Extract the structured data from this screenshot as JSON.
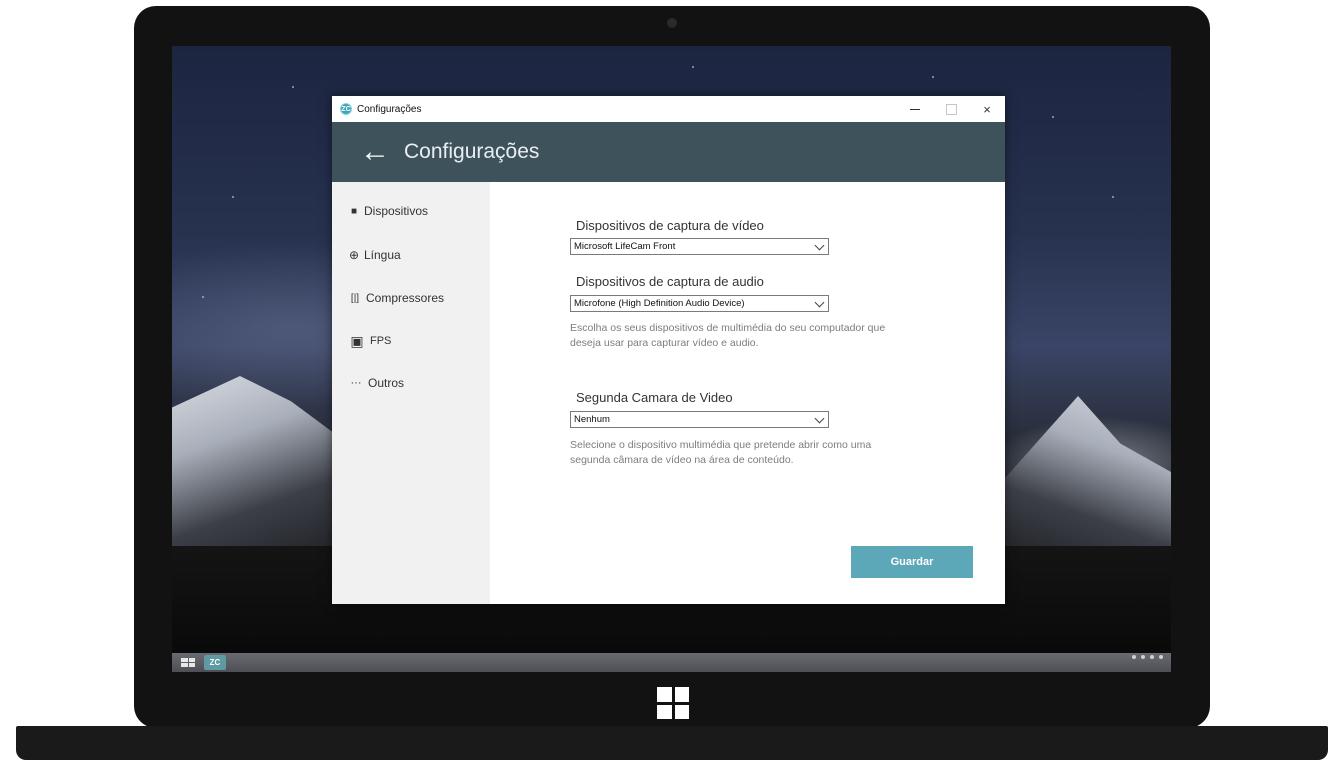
{
  "window": {
    "title": "Configurações",
    "app_icon_text": "ZC",
    "controls": {
      "minimize": "–",
      "maximize": "□",
      "close": "×"
    }
  },
  "header": {
    "back_icon": "←",
    "title": "Configurações"
  },
  "sidebar": {
    "items": [
      {
        "label": "Dispositivos",
        "icon": "camera-icon",
        "glyph": "■"
      },
      {
        "label": "Língua",
        "icon": "globe-icon",
        "glyph": "⊕"
      },
      {
        "label": "Compressores",
        "icon": "compress-icon",
        "glyph": "[|]"
      },
      {
        "label": "FPS",
        "icon": "image-icon",
        "glyph": "▣"
      },
      {
        "label": "Outros",
        "icon": "more-icon",
        "glyph": "···"
      }
    ]
  },
  "content": {
    "video": {
      "label": "Dispositivos de captura de vídeo",
      "value": "Microsoft LifeCam Front"
    },
    "audio": {
      "label": "Dispositivos de captura de audio",
      "value": "Microfone (High Definition Audio Device)"
    },
    "capture_help": "Escolha os seus dispositivos de multimédia do seu computador que deseja usar para capturar vídeo e audio.",
    "second_camera": {
      "label": "Segunda Camara de Video",
      "value": "Nenhum"
    },
    "second_camera_help": "Selecione o dispositivo multimédia que pretende abrir como uma segunda câmara de vídeo na área de conteúdo.",
    "save_label": "Guardar"
  },
  "colors": {
    "header_bg": "#3e525c",
    "accent_button": "#5ca8b9",
    "sidebar_bg": "#f1f1f1"
  }
}
